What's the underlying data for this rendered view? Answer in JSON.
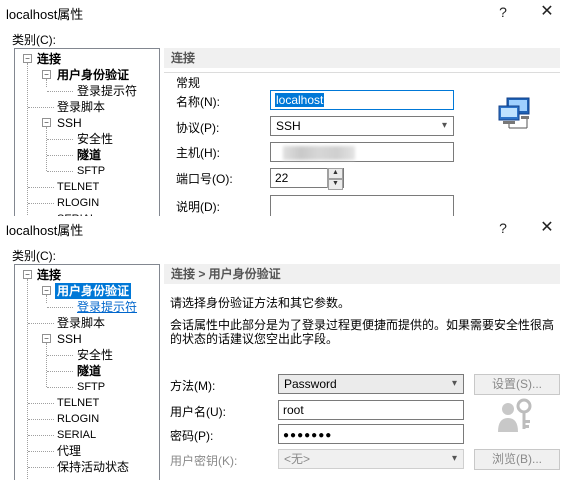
{
  "window1": {
    "title": "localhost属性",
    "category_label": "类别(C):",
    "tree": {
      "connect": "连接",
      "user_auth": "用户身份验证",
      "login_prompt": "登录提示符",
      "login_script": "登录脚本",
      "ssh": "SSH",
      "security": "安全性",
      "tunnel": "隧道",
      "sftp": "SFTP",
      "telnet": "TELNET",
      "rlogin": "RLOGIN"
    },
    "panel_header": "连接",
    "group_label": "常规",
    "fields": {
      "name_label": "名称(N):",
      "name_value": "localhost",
      "protocol_label": "协议(P):",
      "protocol_value": "SSH",
      "host_label": "主机(H):",
      "port_label": "端口号(O):",
      "port_value": "22",
      "desc_label": "说明(D):"
    }
  },
  "window2": {
    "title": "localhost属性",
    "category_label": "类别(C):",
    "tree": {
      "connect": "连接",
      "user_auth": "用户身份验证",
      "login_prompt": "登录提示符",
      "login_script": "登录脚本",
      "ssh": "SSH",
      "security": "安全性",
      "tunnel": "隧道",
      "sftp": "SFTP",
      "telnet": "TELNET",
      "rlogin": "RLOGIN",
      "serial": "SERIAL",
      "proxy": "代理",
      "keepalive": "保持活动状态"
    },
    "panel_header": "连接 > 用户身份验证",
    "hint1": "请选择身份验证方法和其它参数。",
    "hint2": "会话属性中此部分是为了登录过程更便捷而提供的。如果需要安全性很高",
    "hint3": "的状态的话建议您空出此字段。",
    "fields": {
      "method_label": "方法(M):",
      "method_value": "Password",
      "setup_button": "设置(S)...",
      "username_label": "用户名(U):",
      "username_value": "root",
      "password_label": "密码(P):",
      "password_value": "●●●●●●●",
      "userkey_label": "用户密钥(K):",
      "userkey_value": "<无>",
      "browse_button": "浏览(B)..."
    }
  },
  "colors": {
    "selection": "#0078d7",
    "header_bg": "#f0f0f0"
  },
  "icons": {
    "help": "?",
    "close": "✕"
  }
}
